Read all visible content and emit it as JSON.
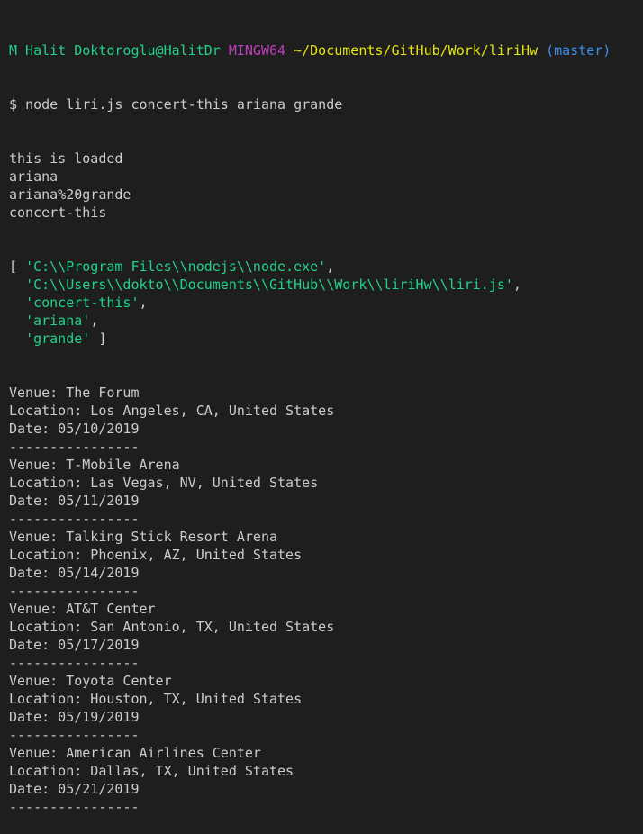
{
  "prompt": {
    "user_host": "M Halit Doktoroglu@HalitDr",
    "system": "MINGW64",
    "path": "~/Documents/GitHub/Work/liriHw",
    "branch": "(master)"
  },
  "command": {
    "symbol": "$",
    "text": "node liri.js concert-this ariana grande"
  },
  "log_lines": [
    "this is loaded",
    "ariana",
    "ariana%20grande",
    "concert-this"
  ],
  "argv": {
    "open": "[ ",
    "items": [
      "'C:\\\\Program Files\\\\nodejs\\\\node.exe'",
      "'C:\\\\Users\\\\dokto\\\\Documents\\\\GitHub\\\\Work\\\\liriHw\\\\liri.js'",
      "'concert-this'",
      "'ariana'",
      "'grande'"
    ],
    "comma": ",",
    "indent": "  ",
    "close": " ]"
  },
  "events": [
    {
      "venue": "Venue: The Forum",
      "location": "Location: Los Angeles, CA, United States",
      "date": "Date: 05/10/2019",
      "separator": "----------------"
    },
    {
      "venue": "Venue: T-Mobile Arena",
      "location": "Location: Las Vegas, NV, United States",
      "date": "Date: 05/11/2019",
      "separator": "----------------"
    },
    {
      "venue": "Venue: Talking Stick Resort Arena",
      "location": "Location: Phoenix, AZ, United States",
      "date": "Date: 05/14/2019",
      "separator": "----------------"
    },
    {
      "venue": "Venue: AT&T Center",
      "location": "Location: San Antonio, TX, United States",
      "date": "Date: 05/17/2019",
      "separator": "----------------"
    },
    {
      "venue": "Venue: Toyota Center",
      "location": "Location: Houston, TX, United States",
      "date": "Date: 05/19/2019",
      "separator": "----------------"
    },
    {
      "venue": "Venue: American Airlines Center",
      "location": "Location: Dallas, TX, United States",
      "date": "Date: 05/21/2019",
      "separator": "----------------"
    }
  ],
  "colors": {
    "background": "#1e1e1e",
    "text": "#cccccc",
    "user_host": "#23d18b",
    "system": "#bc3fbc",
    "path": "#e5e510",
    "branch": "#3b8eea",
    "string": "#23d18b"
  }
}
